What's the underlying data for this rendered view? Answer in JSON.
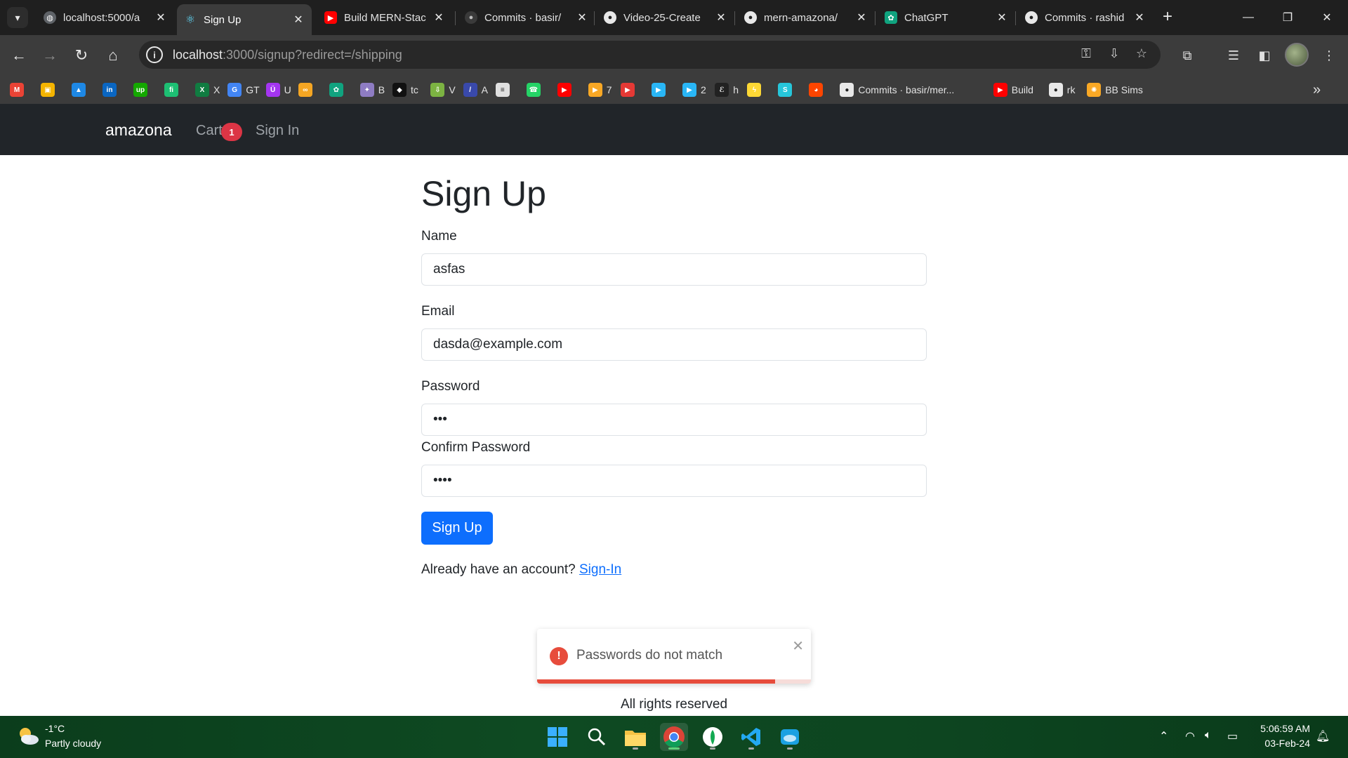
{
  "browser": {
    "tabs": [
      {
        "title": "localhost:5000/a",
        "favicon": "globe-icon",
        "active": false
      },
      {
        "title": "Sign Up",
        "favicon": "react-icon",
        "active": true
      },
      {
        "title": "Build MERN-Stac",
        "favicon": "youtube-icon",
        "active": false
      },
      {
        "title": "Commits · basir/",
        "favicon": "github-icon",
        "active": false
      },
      {
        "title": "Video-25-Create",
        "favicon": "github-icon",
        "active": false
      },
      {
        "title": "mern-amazona/",
        "favicon": "github-icon",
        "active": false
      },
      {
        "title": "ChatGPT",
        "favicon": "chatgpt-icon",
        "active": false
      },
      {
        "title": "Commits · rashid",
        "favicon": "github-icon",
        "active": false
      }
    ],
    "url_host": "localhost",
    "url_rest": ":3000/signup?redirect=/shipping",
    "bookmarks": [
      {
        "label": "",
        "icon": "gmail-icon",
        "color": "#ea4335"
      },
      {
        "label": "",
        "icon": "classroom-icon",
        "color": "#f4b400"
      },
      {
        "label": "",
        "icon": "drive-icon",
        "color": "#1e88e5"
      },
      {
        "label": "",
        "icon": "linkedin-icon",
        "color": "#0a66c2"
      },
      {
        "label": "",
        "icon": "upwork-icon",
        "color": "#14a800"
      },
      {
        "label": "",
        "icon": "fiverr-icon",
        "color": "#1dbf73"
      },
      {
        "label": "X",
        "icon": "excel-icon",
        "color": "#107c41"
      },
      {
        "label": "GT",
        "icon": "google-icon",
        "color": "#4285f4"
      },
      {
        "label": "U",
        "icon": "udemy-icon",
        "color": "#a435f0"
      },
      {
        "label": "",
        "icon": "coursera-icon",
        "color": "#f5a623"
      },
      {
        "label": "",
        "icon": "chatgpt-icon",
        "color": "#10a37f"
      },
      {
        "label": "B",
        "icon": "gemini-icon",
        "color": "#8e7cc3"
      },
      {
        "label": "tc",
        "icon": "tc-icon",
        "color": "#111111"
      },
      {
        "label": "V",
        "icon": "download-icon",
        "color": "#7cb342"
      },
      {
        "label": "A",
        "icon": "a-icon",
        "color": "#3949ab"
      },
      {
        "label": "",
        "icon": "stripes-icon",
        "color": "#e0e0e0"
      },
      {
        "label": "",
        "icon": "whatsapp-icon",
        "color": "#25d366"
      },
      {
        "label": "",
        "icon": "youtube-icon",
        "color": "#ff0000"
      },
      {
        "label": "7",
        "icon": "video-icon",
        "color": "#f9a825"
      },
      {
        "label": "",
        "icon": "play-icon",
        "color": "#e53935"
      },
      {
        "label": "",
        "icon": "play-icon",
        "color": "#29b6f6"
      },
      {
        "label": "2",
        "icon": "play-icon",
        "color": "#29b6f6"
      },
      {
        "label": "h",
        "icon": "e-icon",
        "color": "#222222"
      },
      {
        "label": "",
        "icon": "bolt-icon",
        "color": "#fdd835"
      },
      {
        "label": "",
        "icon": "s-icon",
        "color": "#26c6da"
      },
      {
        "label": "",
        "icon": "reddit-icon",
        "color": "#ff4500"
      },
      {
        "label": "Commits · basir/mer...",
        "icon": "github-icon",
        "color": "#e8e8e8"
      },
      {
        "label": "Build",
        "icon": "youtube-icon",
        "color": "#ff0000"
      },
      {
        "label": "rk",
        "icon": "github-icon",
        "color": "#e8e8e8"
      },
      {
        "label": "BB Sims",
        "icon": "sun-icon",
        "color": "#f9a825"
      }
    ]
  },
  "app": {
    "brand": "amazona",
    "nav": {
      "cart": "Cart",
      "cart_count": "1",
      "signin": "Sign In"
    },
    "title": "Sign Up",
    "form": {
      "name_label": "Name",
      "name_value": "asfas",
      "email_label": "Email",
      "email_value": "dasda@example.com",
      "password_label": "Password",
      "password_value": "•••",
      "confirm_label": "Confirm Password",
      "confirm_value": "••••",
      "submit": "Sign Up"
    },
    "already_text": "Already have an account?",
    "signin_link": "Sign-In",
    "footer": "All rights reserved",
    "colors": {
      "navbar": "#212529",
      "primary": "#0d6efd",
      "danger": "#dc3545"
    }
  },
  "toast": {
    "message": "Passwords do not match",
    "icon": "error-icon",
    "progress_remaining": 0.87
  },
  "taskbar": {
    "weather_temp": "-1°C",
    "weather_desc": "Partly cloudy",
    "time": "5:06:59 AM",
    "date": "03-Feb-24",
    "apps": [
      "windows-start-icon",
      "search-icon",
      "file-explorer-icon",
      "chrome-icon",
      "mongodb-compass-icon",
      "vscode-icon",
      "cloud-app-icon"
    ]
  }
}
